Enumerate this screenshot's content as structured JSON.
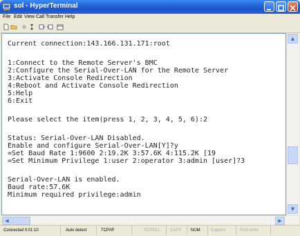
{
  "window": {
    "title": "sol - HyperTerminal"
  },
  "menu": [
    "File",
    "Edit",
    "View",
    "Call",
    "Transfer",
    "Help"
  ],
  "toolbar": {
    "icons": [
      "new-connection-icon",
      "open-icon",
      "disconnect-icon",
      "dial-icon",
      "send-icon",
      "receive-icon",
      "properties-icon"
    ]
  },
  "terminal": {
    "lines": [
      "Current connection:143.166.131.171:root",
      "",
      "1:Connect to the Remote Server's BMC",
      "2:Configure the Serial-Over-LAN for the Remote Server",
      "3:Activate Console Redirection",
      "4:Reboot and Activate Console Redirection",
      "5:Help",
      "6:Exit",
      "",
      "Please select the item(press 1, 2, 3, 4, 5, 6):2",
      "",
      "Status: Serial-Over-LAN Disabled.",
      "Enable and configure Serial-Over-LAN[Y]?y",
      "=Set Baud Rate 1:9600 2:19.2K 3:57.6K 4:115.2K [19",
      "=Set Minimum Privilege 1:user 2:operator 3:admin [user]?3",
      "",
      "Serial-Over-LAN is enabled.",
      "Baud rate:57.6K",
      "Minimum required privilege:admin"
    ]
  },
  "status": {
    "connected": "Connected 0:01:10",
    "detect": "Auto detect",
    "protocol": "TCP/IP",
    "scroll": "SCROLL",
    "caps": "CAPS",
    "num": "NUM",
    "capture": "Capture",
    "print_echo": "Print echo"
  }
}
